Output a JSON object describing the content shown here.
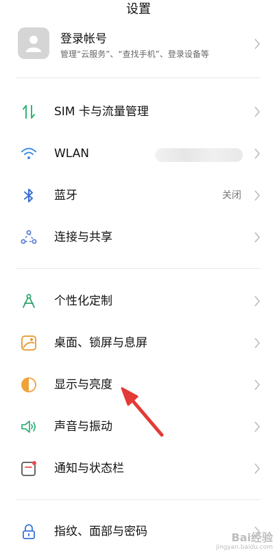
{
  "header": {
    "title": "设置"
  },
  "account": {
    "title": "登录帐号",
    "subtitle": "管理“云服务”、“查找手机”、登录设备等"
  },
  "sections": [
    {
      "items": [
        {
          "label": "SIM 卡与流量管理",
          "icon": "sim-data-icon",
          "value": ""
        },
        {
          "label": "WLAN",
          "icon": "wifi-icon",
          "value": ""
        },
        {
          "label": "蓝牙",
          "icon": "bluetooth-icon",
          "value": "关闭"
        },
        {
          "label": "连接与共享",
          "icon": "connection-share-icon",
          "value": ""
        }
      ]
    },
    {
      "items": [
        {
          "label": "个性化定制",
          "icon": "compass-icon",
          "value": ""
        },
        {
          "label": "桌面、锁屏与息屏",
          "icon": "wallpaper-icon",
          "value": ""
        },
        {
          "label": "显示与亮度",
          "icon": "brightness-icon",
          "value": ""
        },
        {
          "label": "声音与振动",
          "icon": "speaker-icon",
          "value": ""
        },
        {
          "label": "通知与状态栏",
          "icon": "notification-icon",
          "value": ""
        }
      ]
    },
    {
      "items": [
        {
          "label": "指纹、面部与密码",
          "icon": "lock-icon",
          "value": ""
        }
      ]
    }
  ],
  "watermark": {
    "brand": "Bai经验",
    "sub": "jingyan.baidu.com"
  },
  "colors": {
    "sim": "#2bb673",
    "wifi": "#3a8be0",
    "bluetooth": "#3a6fd8",
    "connection": "#5b7fd0",
    "compass": "#2aa36a",
    "wallpaper": "#e8962f",
    "brightness": "#f0a23a",
    "speaker": "#35b37b",
    "notification": "#f04848",
    "lock": "#3a72d8",
    "arrow": "#e33b35"
  }
}
